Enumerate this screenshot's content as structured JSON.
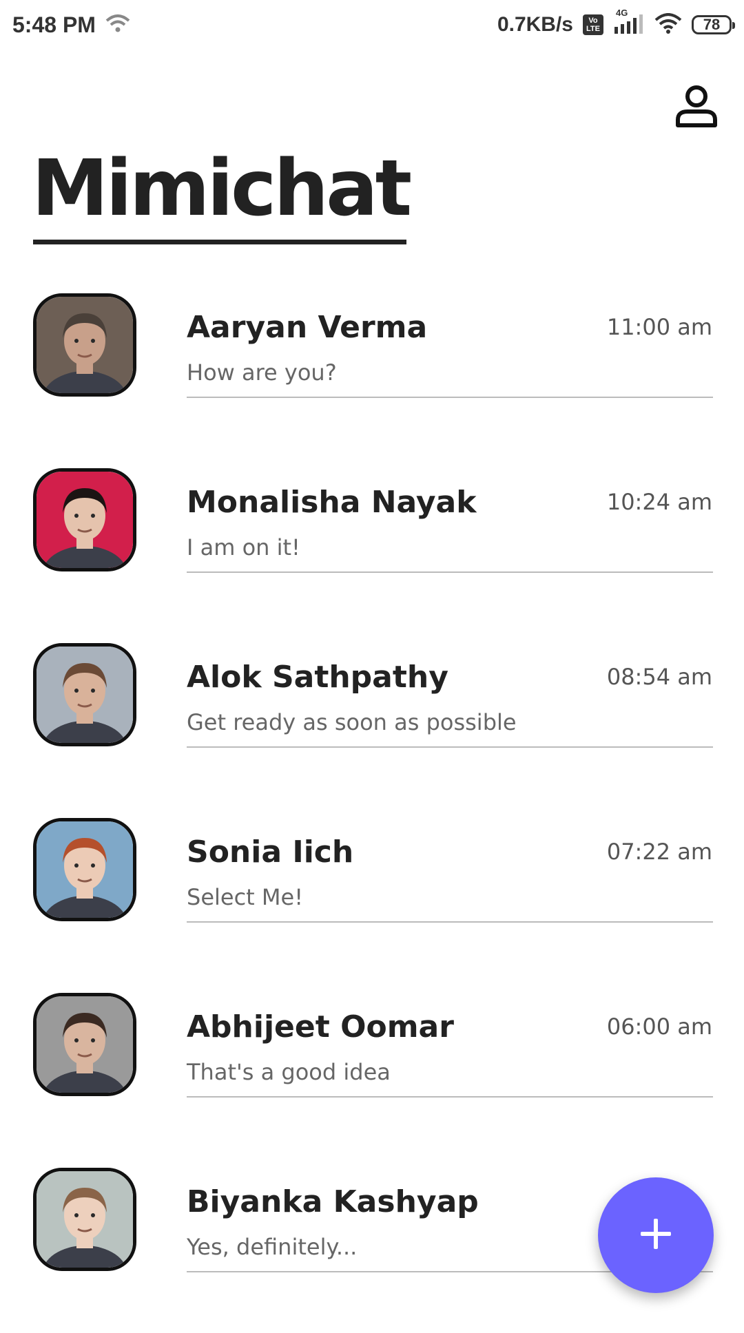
{
  "status_bar": {
    "time": "5:48 PM",
    "net_speed": "0.7KB/s",
    "volte_top": "Vo",
    "volte_bottom": "LTE",
    "network_type": "4G",
    "battery": "78"
  },
  "header": {
    "title": "Mimichat",
    "profile_icon": "person-icon"
  },
  "chats": [
    {
      "name": "Aaryan Verma",
      "time": "11:00 am",
      "message": "How are you?",
      "avatar_bg": "#6d5f55",
      "avatar_skin": "#c8a08a",
      "avatar_hair": "#4a4039"
    },
    {
      "name": "Monalisha Nayak",
      "time": "10:24 am",
      "message": "I am on it!",
      "avatar_bg": "#d21f4b",
      "avatar_skin": "#e5c3ad",
      "avatar_hair": "#1b1413"
    },
    {
      "name": "Alok Sathpathy",
      "time": "08:54 am",
      "message": "Get ready as soon as possible",
      "avatar_bg": "#a9b2bc",
      "avatar_skin": "#d9b29a",
      "avatar_hair": "#6b4a36"
    },
    {
      "name": "Sonia Iich",
      "time": "07:22 am",
      "message": "Select Me!",
      "avatar_bg": "#7fa8c8",
      "avatar_skin": "#eccbb6",
      "avatar_hair": "#b5502c"
    },
    {
      "name": "Abhijeet Oomar",
      "time": "06:00 am",
      "message": "That's a good idea",
      "avatar_bg": "#9a9a9a",
      "avatar_skin": "#d9b59f",
      "avatar_hair": "#3b2a22"
    },
    {
      "name": "Biyanka Kashyap",
      "time": "",
      "message": "Yes, definitely...",
      "avatar_bg": "#b9c3c0",
      "avatar_skin": "#edd0bd",
      "avatar_hair": "#8a6448"
    }
  ],
  "fab": {
    "icon": "plus-icon",
    "color": "#6b63ff"
  }
}
